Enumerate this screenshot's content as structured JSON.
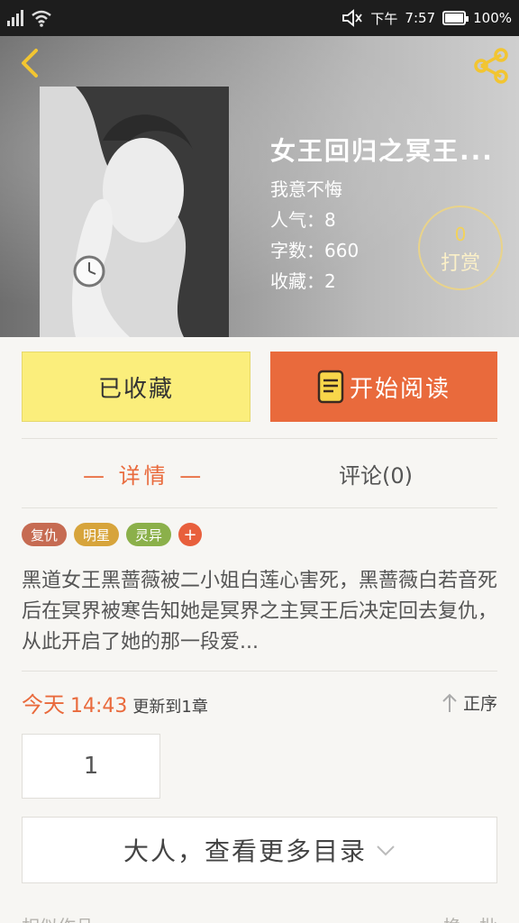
{
  "status_bar": {
    "time_prefix": "下午",
    "time": "7:57",
    "battery": "100%",
    "battery_level": 1.0,
    "icons": [
      "signal-icon",
      "wifi-icon",
      "mute-icon",
      "battery-icon"
    ]
  },
  "header": {
    "back_icon": "chevron-left-icon",
    "share_icon": "share-icon",
    "title": "女王回归之冥王...",
    "author": "我意不悔",
    "popularity": "人气：8",
    "word_count": "字数：660",
    "favorites": "收藏：2",
    "tip": {
      "count": "0",
      "label": "打赏"
    }
  },
  "actions": {
    "collected_label": "已收藏",
    "read_label": "开始阅读",
    "read_icon": "book-icon"
  },
  "tabs": {
    "detail": "— 详情 —",
    "comments": "评论(0)"
  },
  "tags": [
    {
      "label": "复仇",
      "color": "#c66b52"
    },
    {
      "label": "明星",
      "color": "#d7a43b"
    },
    {
      "label": "灵异",
      "color": "#8bb04a"
    }
  ],
  "tag_add_label": "+",
  "description": "黑道女王黑蔷薇被二小姐白莲心害死，黑蔷薇白若音死后在冥界被寒告知她是冥界之主冥王后决定回去复仇，从此开启了她的那一段爱...",
  "update": {
    "today": "今天",
    "time": "14:43",
    "text": "更新到1章",
    "order_label": "正序"
  },
  "chapter_number": "1",
  "more_catalog": "大人，查看更多目录",
  "similar_label": "相似作品",
  "change_label": "换一批",
  "colors": {
    "accent": "#e96a3c",
    "collected_bg": "#fbee7c",
    "tip_gold": "#f2d25b"
  }
}
